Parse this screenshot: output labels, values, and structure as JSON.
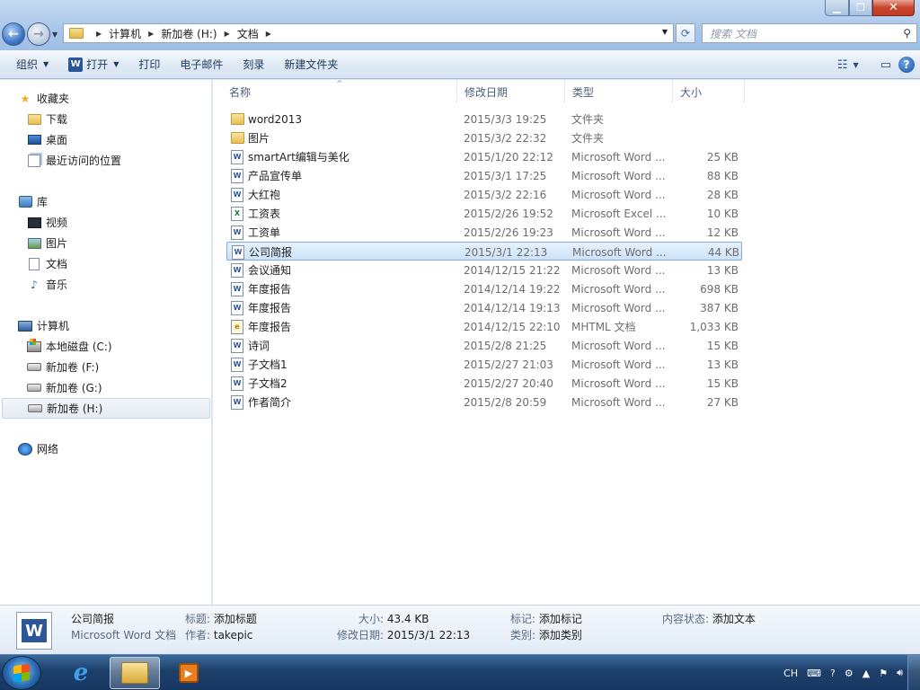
{
  "window": {
    "minimize_icon": "minimize-icon",
    "maximize_icon": "maximize-icon",
    "close_icon": "close-icon"
  },
  "address": {
    "crumbs": [
      "计算机",
      "新加卷 (H:)",
      "文档"
    ]
  },
  "search": {
    "placeholder": "搜索 文档"
  },
  "toolbar": {
    "organize": "组织",
    "open": "打开",
    "print": "打印",
    "email": "电子邮件",
    "burn": "刻录",
    "new_folder": "新建文件夹"
  },
  "sidebar": {
    "favorites": {
      "label": "收藏夹",
      "items": [
        "下载",
        "桌面",
        "最近访问的位置"
      ]
    },
    "libraries": {
      "label": "库",
      "items": [
        "视频",
        "图片",
        "文档",
        "音乐"
      ]
    },
    "computer": {
      "label": "计算机",
      "items": [
        "本地磁盘 (C:)",
        "新加卷 (F:)",
        "新加卷 (G:)",
        "新加卷 (H:)"
      ]
    },
    "network": {
      "label": "网络"
    }
  },
  "columns": {
    "name": "名称",
    "date": "修改日期",
    "type": "类型",
    "size": "大小"
  },
  "files": [
    {
      "name": "word2013",
      "date": "2015/3/3 19:25",
      "type": "文件夹",
      "size": "",
      "icon": "folder-icon"
    },
    {
      "name": "图片",
      "date": "2015/3/2 22:32",
      "type": "文件夹",
      "size": "",
      "icon": "folder-icon"
    },
    {
      "name": "smartArt编辑与美化",
      "date": "2015/1/20 22:12",
      "type": "Microsoft Word ...",
      "size": "25 KB",
      "icon": "word-icon"
    },
    {
      "name": "产品宣传单",
      "date": "2015/3/1 17:25",
      "type": "Microsoft Word ...",
      "size": "88 KB",
      "icon": "word-icon"
    },
    {
      "name": "大红袍",
      "date": "2015/3/2 22:16",
      "type": "Microsoft Word ...",
      "size": "28 KB",
      "icon": "word-icon"
    },
    {
      "name": "工资表",
      "date": "2015/2/26 19:52",
      "type": "Microsoft Excel ...",
      "size": "10 KB",
      "icon": "excel-icon"
    },
    {
      "name": "工资单",
      "date": "2015/2/26 19:23",
      "type": "Microsoft Word ...",
      "size": "12 KB",
      "icon": "word-icon"
    },
    {
      "name": "公司简报",
      "date": "2015/3/1 22:13",
      "type": "Microsoft Word ...",
      "size": "44 KB",
      "icon": "word-icon"
    },
    {
      "name": "会议通知",
      "date": "2014/12/15 21:22",
      "type": "Microsoft Word ...",
      "size": "13 KB",
      "icon": "word-icon"
    },
    {
      "name": "年度报告",
      "date": "2014/12/14 19:22",
      "type": "Microsoft Word ...",
      "size": "698 KB",
      "icon": "word-icon"
    },
    {
      "name": "年度报告",
      "date": "2014/12/14 19:13",
      "type": "Microsoft Word ...",
      "size": "387 KB",
      "icon": "word-icon"
    },
    {
      "name": "年度报告",
      "date": "2014/12/15 22:10",
      "type": "MHTML 文档",
      "size": "1,033 KB",
      "icon": "mhtml-icon"
    },
    {
      "name": "诗词",
      "date": "2015/2/8 21:25",
      "type": "Microsoft Word ...",
      "size": "15 KB",
      "icon": "word-icon"
    },
    {
      "name": "子文档1",
      "date": "2015/2/27 21:03",
      "type": "Microsoft Word ...",
      "size": "13 KB",
      "icon": "word-icon"
    },
    {
      "name": "子文档2",
      "date": "2015/2/27 20:40",
      "type": "Microsoft Word ...",
      "size": "15 KB",
      "icon": "word-icon"
    },
    {
      "name": "作者简介",
      "date": "2015/2/8 20:59",
      "type": "Microsoft Word ...",
      "size": "27 KB",
      "icon": "word-icon"
    }
  ],
  "selected_index": 7,
  "details": {
    "name": "公司简报",
    "type": "Microsoft Word 文档",
    "title_label": "标题:",
    "title_value": "添加标题",
    "author_label": "作者:",
    "author_value": "takepic",
    "size_label": "大小:",
    "size_value": "43.4 KB",
    "modified_label": "修改日期:",
    "modified_value": "2015/3/1 22:13",
    "tags_label": "标记:",
    "tags_value": "添加标记",
    "category_label": "类别:",
    "category_value": "添加类别",
    "content_label": "内容状态:",
    "content_value": "添加文本"
  },
  "taskbar": {
    "tray_lang": "CH"
  },
  "colors": {
    "selection_bg": "#cde3f9",
    "selection_border": "#84acdd",
    "taskbar": "#1c3f6a"
  }
}
